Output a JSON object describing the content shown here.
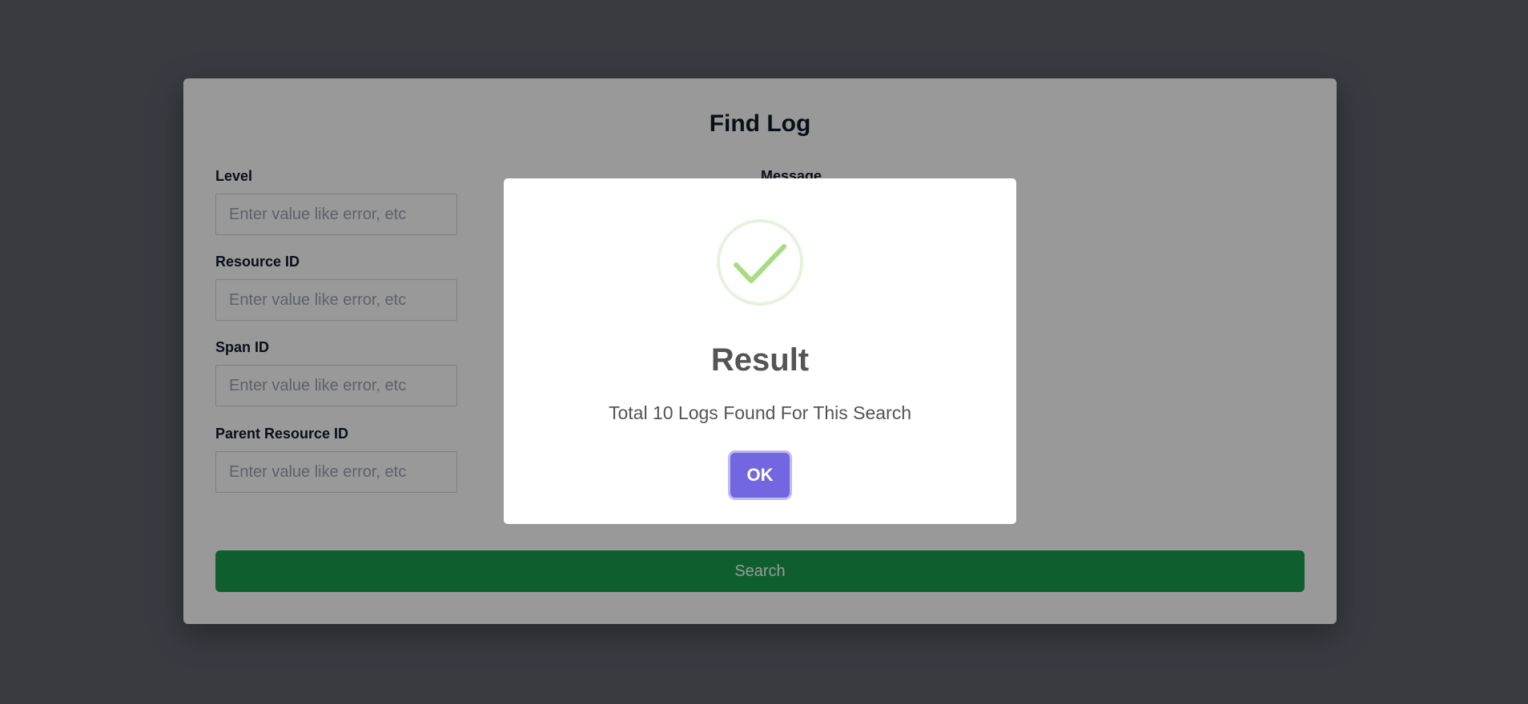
{
  "page": {
    "title": "Find Log"
  },
  "form": {
    "fields": [
      {
        "label": "Level",
        "placeholder": "Enter value like error, etc"
      },
      {
        "label": "Resource ID",
        "placeholder": "Enter value like error, etc"
      },
      {
        "label": "Span ID",
        "placeholder": "Enter value like error, etc"
      },
      {
        "label": "Parent Resource ID",
        "placeholder": "Enter value like error, etc"
      },
      {
        "label": "Message"
      }
    ],
    "search_label": "Search"
  },
  "modal": {
    "icon": "check-circle-icon",
    "title": "Result",
    "text": "Total 10 Logs Found For This Search",
    "ok_label": "OK"
  },
  "colors": {
    "backdrop": "#5f636d",
    "search_button": "#1a9e4d",
    "ok_button": "#7267e0",
    "success_icon": "#a5dc86"
  }
}
